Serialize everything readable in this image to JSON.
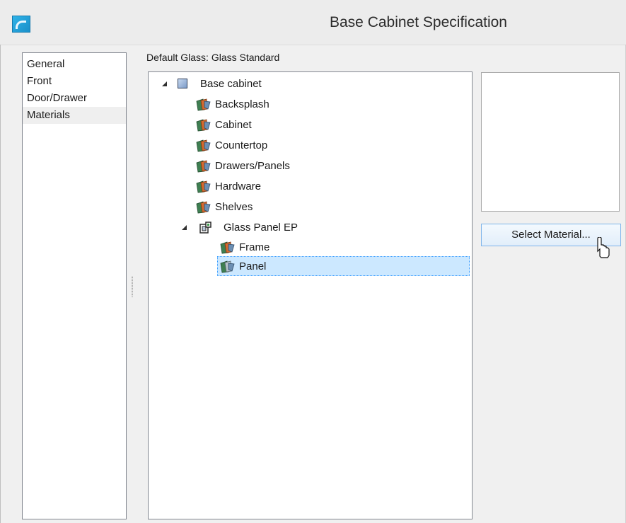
{
  "window": {
    "title": "Base Cabinet Specification",
    "icon": "app-logo-icon"
  },
  "nav": {
    "items": [
      {
        "label": "General",
        "selected": false
      },
      {
        "label": "Front",
        "selected": false
      },
      {
        "label": "Door/Drawer",
        "selected": false
      },
      {
        "label": "Materials",
        "selected": true
      }
    ]
  },
  "materials": {
    "default_glass": "Default Glass: Glass  Standard",
    "tree": {
      "root": "Base cabinet",
      "children": [
        "Backsplash",
        "Cabinet",
        "Countertop",
        "Drawers/Panels",
        "Hardware",
        "Shelves"
      ],
      "group": "Glass Panel EP",
      "group_children": [
        "Frame",
        "Panel"
      ],
      "selected": "Panel"
    },
    "select_button": "Select Material..."
  },
  "colors": {
    "selection_bg": "#cce8ff",
    "button_border": "#7eb4ea",
    "accent": "#1a8fc9"
  }
}
